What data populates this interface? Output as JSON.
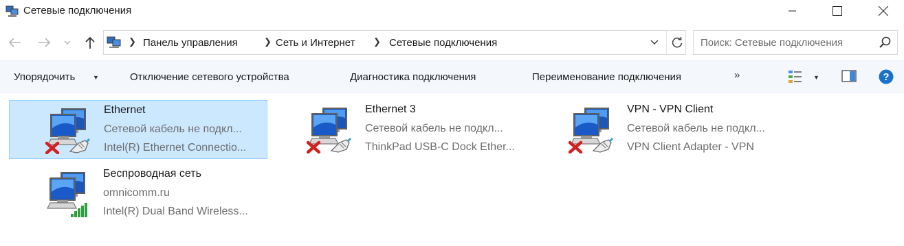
{
  "window": {
    "title": "Сетевые подключения",
    "icon": "network-connections-icon"
  },
  "address_bar": {
    "breadcrumbs": [
      "Панель управления",
      "Сеть и Интернет",
      "Сетевые подключения"
    ]
  },
  "search": {
    "placeholder": "Поиск: Сетевые подключения"
  },
  "toolbar": {
    "organize": "Упорядочить",
    "disable_device": "Отключение сетевого устройства",
    "diagnose": "Диагностика подключения",
    "rename": "Переименование подключения",
    "more": "»"
  },
  "connections": [
    {
      "name": "Ethernet",
      "status": "Сетевой кабель не подкл...",
      "adapter": "Intel(R) Ethernet Connectio...",
      "state": "disconnected",
      "selected": true
    },
    {
      "name": "Ethernet 3",
      "status": "Сетевой кабель не подкл...",
      "adapter": "ThinkPad USB-C Dock Ether...",
      "state": "disconnected",
      "selected": false
    },
    {
      "name": "VPN - VPN Client",
      "status": "Сетевой кабель не подкл...",
      "adapter": "VPN Client Adapter - VPN",
      "state": "disconnected",
      "selected": false
    },
    {
      "name": "Беспроводная сеть",
      "status": "omnicomm.ru",
      "adapter": "Intel(R) Dual Band Wireless...",
      "state": "connected-wifi",
      "selected": false
    }
  ],
  "colors": {
    "selection_bg": "#cce8ff",
    "selection_border": "#99d1ff",
    "toolbar_bg": "#f4f7fc",
    "help_blue": "#1a73c9",
    "error_red": "#d32121",
    "signal_green": "#2e9e3e"
  }
}
